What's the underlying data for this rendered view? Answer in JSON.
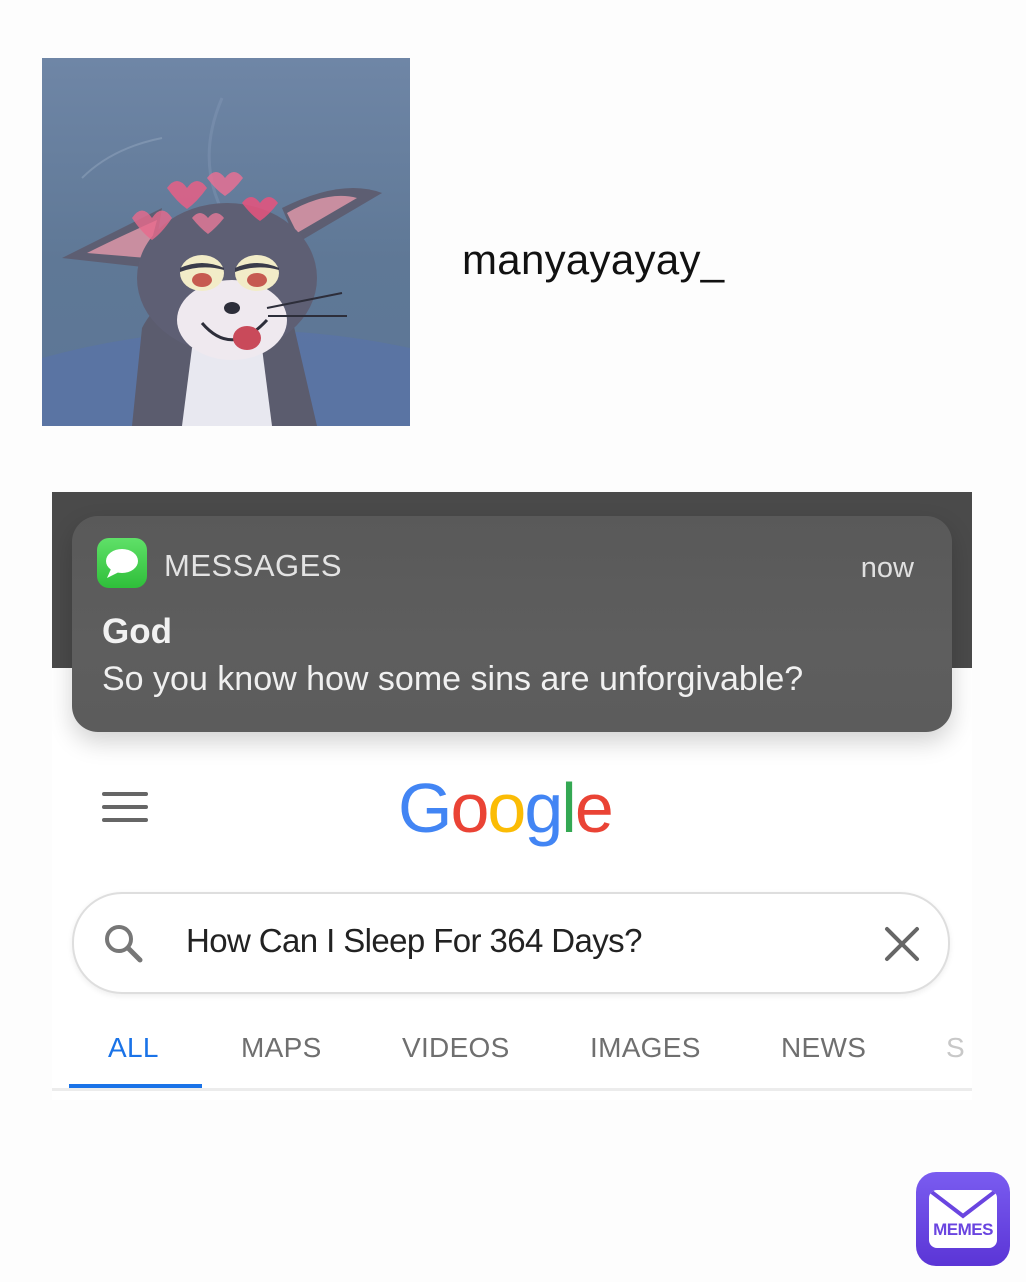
{
  "profile": {
    "username": "manyayayay_",
    "avatar_icon": "cartoon-cat-avatar"
  },
  "notification": {
    "app_name": "MESSAGES",
    "time": "now",
    "title": "God",
    "body": "So you know how some sins are unforgivable?",
    "app_icon": "messages-bubble-icon",
    "app_icon_color": "#34c13f"
  },
  "google": {
    "logo_letters": [
      "G",
      "o",
      "o",
      "g",
      "l",
      "e"
    ],
    "logo_colors": [
      "#4285f4",
      "#ea4335",
      "#fbbc05",
      "#4285f4",
      "#34a853",
      "#ea4335"
    ],
    "search_value": "How Can I Sleep For 364 Days?",
    "tabs": [
      "ALL",
      "MAPS",
      "VIDEOS",
      "IMAGES",
      "NEWS",
      "S"
    ],
    "active_tab": "ALL",
    "accent": "#1a73e8"
  },
  "watermark": {
    "label": "MEMES"
  }
}
